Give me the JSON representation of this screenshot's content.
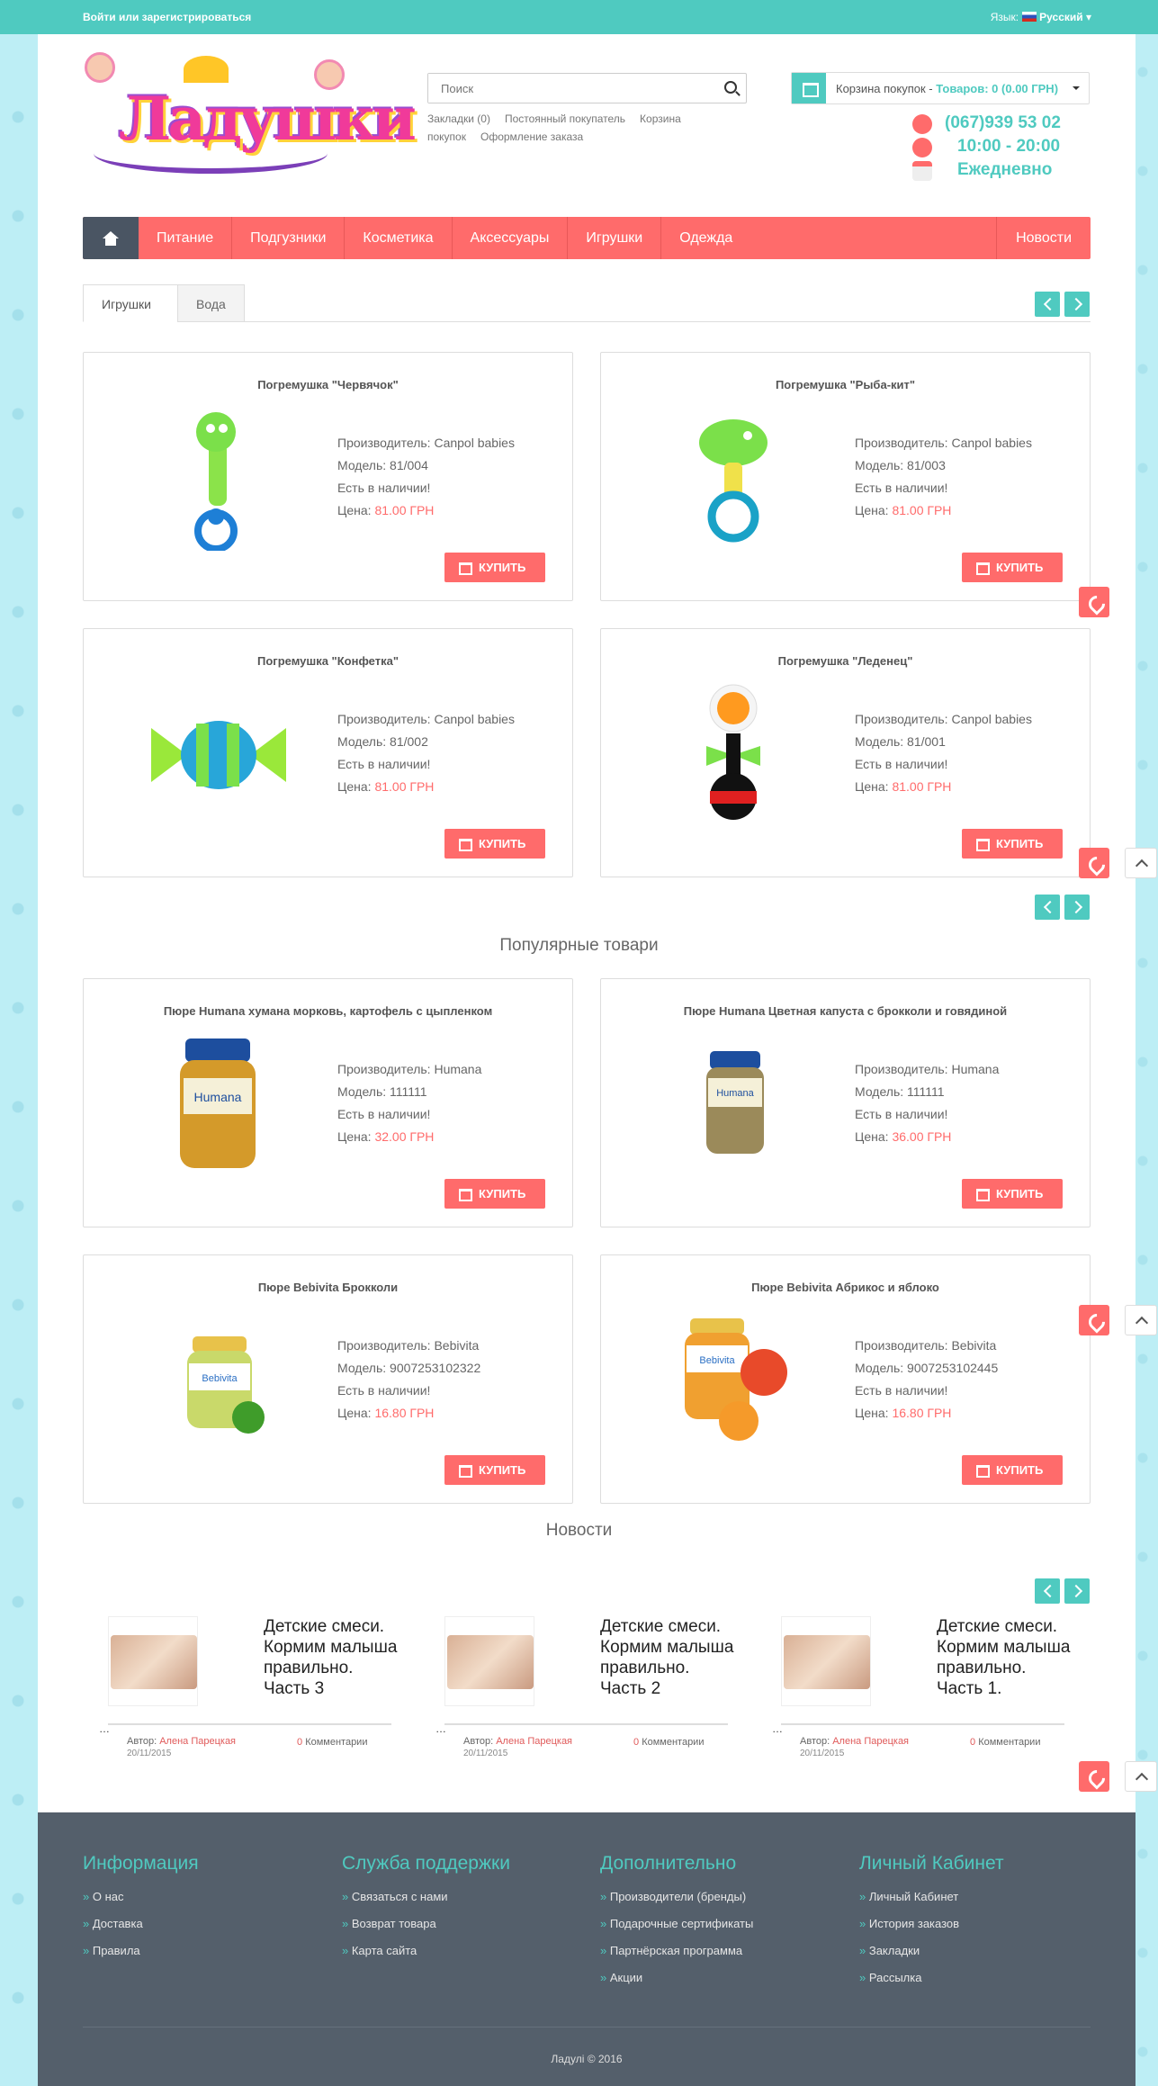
{
  "topbar": {
    "login": "Войти или зарегистрироваться",
    "lang_label": "Язык:",
    "lang_value": "Русский"
  },
  "header": {
    "logo_text": "Ладушки",
    "search_placeholder": "Поиск",
    "links": [
      "Закладки (0)",
      "Постоянный покупатель",
      "Корзина покупок",
      "Оформление заказа"
    ],
    "cart_label": "Корзина покупок - ",
    "cart_value": "Товаров: 0 (0.00 ГРН)",
    "phone": "(067)939 53 02",
    "hours": "10:00 - 20:00",
    "days": "Ежедневно"
  },
  "nav": {
    "items": [
      "Питание",
      "Подгузники",
      "Косметика",
      "Аксессуары",
      "Игрушки",
      "Одежда"
    ],
    "news": "Новости"
  },
  "tabs": [
    "Игрушки",
    "Вода"
  ],
  "labels": {
    "maker": "Производитель: ",
    "model": "Модель: ",
    "stock": "Есть в наличии!",
    "price": "Цена: ",
    "buy": "КУПИТЬ",
    "popular": "Популярные товари",
    "news": "Новости",
    "author": "Автор: ",
    "comments": "Комментарии"
  },
  "toys": [
    {
      "name": "Погремушка \"Червячок\"",
      "maker": "Canpol babies",
      "model": "81/004",
      "price": "81.00 ГРН"
    },
    {
      "name": "Погремушка \"Рыба-кит\"",
      "maker": "Canpol babies",
      "model": "81/003",
      "price": "81.00 ГРН"
    },
    {
      "name": "Погремушка \"Конфетка\"",
      "maker": "Canpol babies",
      "model": "81/002",
      "price": "81.00 ГРН"
    },
    {
      "name": "Погремушка \"Леденец\"",
      "maker": "Canpol babies",
      "model": "81/001",
      "price": "81.00 ГРН"
    }
  ],
  "popular": [
    {
      "name": "Пюре Humana хумана морковь, картофель с цыпленком",
      "maker": "Humana",
      "model": "111111",
      "price": "32.00 ГРН"
    },
    {
      "name": "Пюре Humana Цветная капуста с брокколи и говядиной",
      "maker": "Humana",
      "model": "111111",
      "price": "36.00 ГРН"
    },
    {
      "name": "Пюре Bebivita Брокколи",
      "maker": "Bebivita",
      "model": "9007253102322",
      "price": "16.80 ГРН"
    },
    {
      "name": "Пюре Bebivita Абрикос и яблоко",
      "maker": "Bebivita",
      "model": "9007253102445",
      "price": "16.80 ГРН"
    }
  ],
  "news": [
    {
      "title": "Детские смеси. Кормим малыша правильно. Часть 3",
      "author": "Алена Парецкая",
      "date": "20/11/2015",
      "comments": "0"
    },
    {
      "title": "Детские смеси. Кормим малыша правильно. Часть 2",
      "author": "Алена Парецкая",
      "date": "20/11/2015",
      "comments": "0"
    },
    {
      "title": "Детские смеси. Кормим малыша правильно. Часть 1.",
      "author": "Алена Парецкая",
      "date": "20/11/2015",
      "comments": "0"
    }
  ],
  "footer": {
    "cols": [
      {
        "title": "Информация",
        "items": [
          "О нас",
          "Доставка",
          "Правила"
        ]
      },
      {
        "title": "Служба поддержки",
        "items": [
          "Связаться с нами",
          "Возврат товара",
          "Карта сайта"
        ]
      },
      {
        "title": "Дополнительно",
        "items": [
          "Производители (бренды)",
          "Подарочные сертификаты",
          "Партнёрская программа",
          "Акции"
        ]
      },
      {
        "title": "Личный Кабинет",
        "items": [
          "Личный Кабинет",
          "История заказов",
          "Закладки",
          "Рассылка"
        ]
      }
    ],
    "copyright": "Ладулі © 2016"
  },
  "colors": {
    "accent": "#4fcac0",
    "red": "#ff6b6b",
    "footer": "#545f6b"
  }
}
